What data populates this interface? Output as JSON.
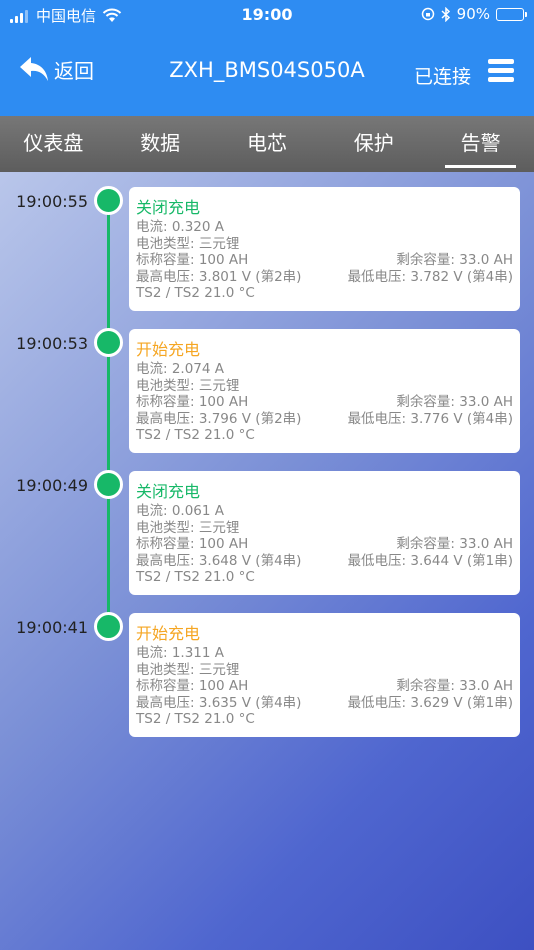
{
  "status_bar": {
    "carrier": "中国电信",
    "time": "19:00",
    "battery": "90%",
    "battery_level": 0.9,
    "icons": [
      "signal-icon",
      "wifi-icon",
      "orientation-lock-icon",
      "bluetooth-icon",
      "battery-icon"
    ]
  },
  "nav": {
    "back_label": "返回",
    "title": "ZXH_BMS04S050A",
    "connection": "已连接"
  },
  "tabs": [
    {
      "label": "仪表盘",
      "active": false
    },
    {
      "label": "数据",
      "active": false
    },
    {
      "label": "电芯",
      "active": false
    },
    {
      "label": "保护",
      "active": false
    },
    {
      "label": "告警",
      "active": true
    }
  ],
  "colors": {
    "nav_blue": "#2e8cf2",
    "timeline_green": "#17b868",
    "event_close_green": "#17b868",
    "event_open_orange": "#f5a623"
  },
  "alarms": [
    {
      "time": "19:00:55",
      "event": "关闭充电",
      "event_color": "#17b868",
      "current": "电流:  0.320 A",
      "battery_type": "电池类型: 三元锂",
      "capacity": "标称容量: 100 AH",
      "remaining": "剩余容量: 33.0 AH",
      "max_voltage": "最高电压: 3.801 V (第2串)",
      "min_voltage": "最低电压: 3.782 V (第4串)",
      "temp": "TS2 / TS2 21.0 °C"
    },
    {
      "time": "19:00:53",
      "event": "开始充电",
      "event_color": "#f5a623",
      "current": "电流:  2.074 A",
      "battery_type": "电池类型: 三元锂",
      "capacity": "标称容量: 100 AH",
      "remaining": "剩余容量: 33.0 AH",
      "max_voltage": "最高电压: 3.796 V (第2串)",
      "min_voltage": "最低电压: 3.776 V (第4串)",
      "temp": "TS2 / TS2 21.0 °C"
    },
    {
      "time": "19:00:49",
      "event": "关闭充电",
      "event_color": "#17b868",
      "current": "电流:  0.061 A",
      "battery_type": "电池类型: 三元锂",
      "capacity": "标称容量: 100 AH",
      "remaining": "剩余容量: 33.0 AH",
      "max_voltage": "最高电压: 3.648 V (第4串)",
      "min_voltage": "最低电压: 3.644 V (第1串)",
      "temp": "TS2 / TS2 21.0 °C"
    },
    {
      "time": "19:00:41",
      "event": "开始充电",
      "event_color": "#f5a623",
      "current": "电流:  1.311 A",
      "battery_type": "电池类型: 三元锂",
      "capacity": "标称容量: 100 AH",
      "remaining": "剩余容量: 33.0 AH",
      "max_voltage": "最高电压: 3.635 V (第4串)",
      "min_voltage": "最低电压: 3.629 V (第1串)",
      "temp": "TS2 / TS2 21.0 °C"
    }
  ]
}
